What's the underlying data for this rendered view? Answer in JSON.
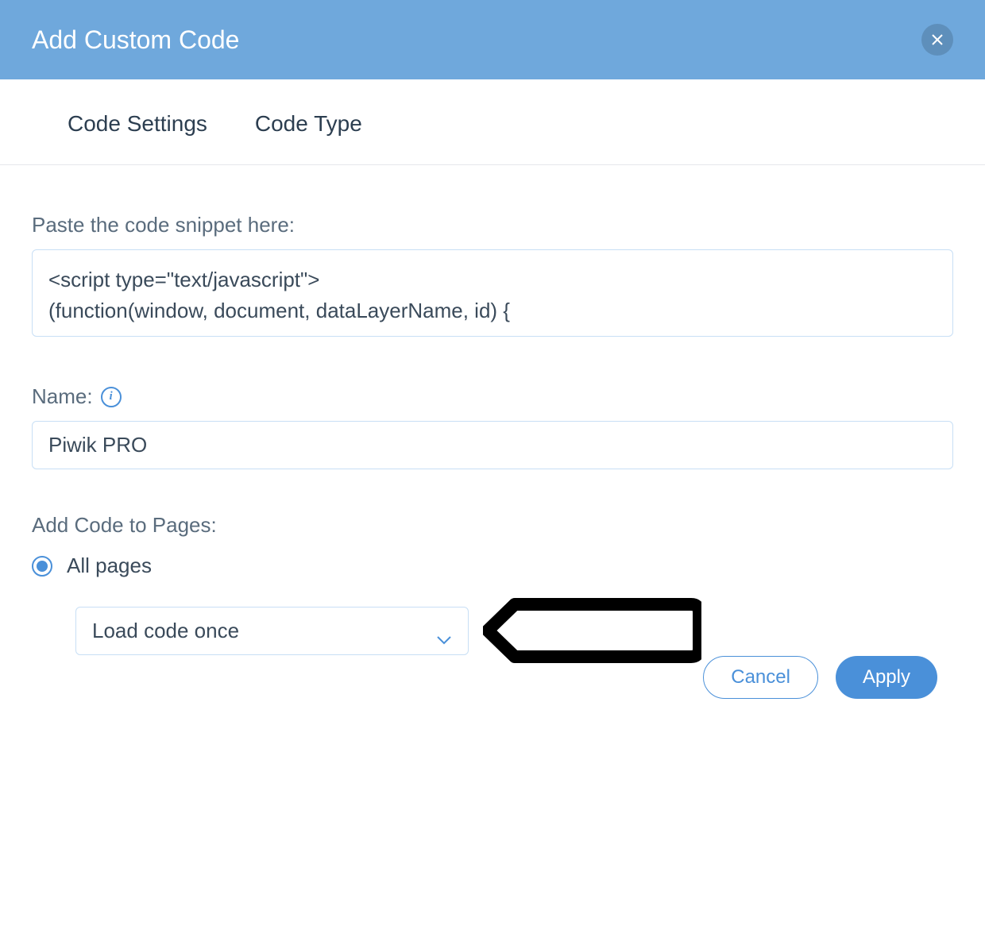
{
  "header": {
    "title": "Add Custom Code"
  },
  "tabs": [
    {
      "label": "Code Settings"
    },
    {
      "label": "Code Type"
    }
  ],
  "fields": {
    "code_snippet": {
      "label": "Paste the code snippet here:",
      "value": "<script type=\"text/javascript\">\n(function(window, document, dataLayerName, id) {"
    },
    "name": {
      "label": "Name:",
      "value": "Piwik PRO"
    },
    "add_to_pages": {
      "label": "Add Code to Pages:",
      "options": {
        "all_pages": "All pages"
      },
      "load_select": "Load code once"
    }
  },
  "footer": {
    "cancel": "Cancel",
    "apply": "Apply"
  }
}
